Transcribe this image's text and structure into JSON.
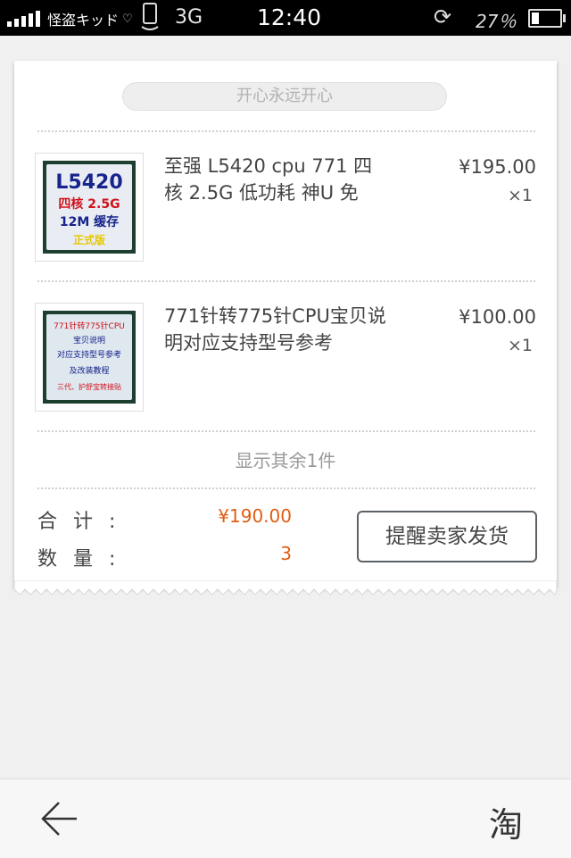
{
  "status_bar": {
    "carrier": "怪盗キッド",
    "network": "3G",
    "time": "12:40",
    "battery_percent": "27％",
    "battery_level": 0.27
  },
  "order": {
    "shop_name": "开心永远开心",
    "items": [
      {
        "title": "至强 L5420 cpu 771 四核 2.5G 低功耗 神U 免",
        "price": "¥195.00",
        "quantity": "×1",
        "thumb_text": [
          "L5420",
          "四核 2.5G",
          "12M 缓存",
          "正式版"
        ]
      },
      {
        "title": "771针转775针CPU宝贝说明对应支持型号参考",
        "price": "¥100.00",
        "quantity": "×1",
        "thumb_text": [
          "771针转775针CPU",
          "宝贝说明",
          "对应支持型号参考",
          "及改装教程",
          "三代、护舒宝转接贴"
        ]
      }
    ],
    "show_more": "显示其余1件",
    "summary": {
      "total_label": "合计:",
      "total_value": "¥190.00",
      "count_label": "数量:",
      "count_value": "3"
    },
    "remind_button": "提醒卖家发货"
  },
  "bottom_bar": {
    "back_icon": "arrow-left-icon",
    "taobao_label": "淘"
  },
  "colors": {
    "accent_price": "#e25d12",
    "background": "#f0f0f0"
  }
}
